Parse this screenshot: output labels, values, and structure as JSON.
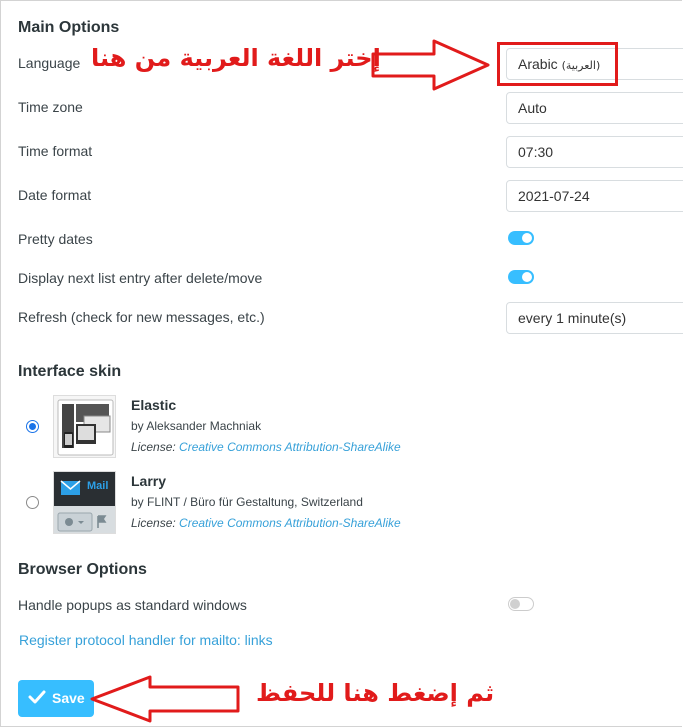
{
  "main_options": {
    "title": "Main Options",
    "language": {
      "label": "Language",
      "value": "Arabic",
      "value_native": "(العربية)"
    },
    "timezone": {
      "label": "Time zone",
      "value": "Auto"
    },
    "time_format": {
      "label": "Time format",
      "value": "07:30"
    },
    "date_format": {
      "label": "Date format",
      "value": "2021-07-24"
    },
    "pretty_dates": {
      "label": "Pretty dates",
      "enabled": true
    },
    "next_entry": {
      "label": "Display next list entry after delete/move",
      "enabled": true
    },
    "refresh": {
      "label": "Refresh (check for new messages, etc.)",
      "value": "every 1 minute(s)"
    }
  },
  "interface_skin": {
    "title": "Interface skin",
    "skins": [
      {
        "name": "Elastic",
        "by": "by Aleksander Machniak",
        "license_label": "License:",
        "license": "Creative Commons Attribution-ShareAlike",
        "selected": true
      },
      {
        "name": "Larry",
        "by": "by FLINT / Büro für Gestaltung, Switzerland",
        "license_label": "License:",
        "license": "Creative Commons Attribution-ShareAlike",
        "selected": false,
        "thumb_text": "Mail"
      }
    ]
  },
  "browser_options": {
    "title": "Browser Options",
    "popups": {
      "label": "Handle popups as standard windows",
      "enabled": false
    },
    "protocol_link": "Register protocol handler for mailto: links"
  },
  "save_button": {
    "label": "Save"
  },
  "annotations": {
    "top": "إختر اللغة العربية من هنا",
    "bottom": "ثم إضغط هنا للحفظ",
    "color": "#e11b1b"
  },
  "colors": {
    "accent": "#37beff",
    "link": "#37a1d9"
  }
}
